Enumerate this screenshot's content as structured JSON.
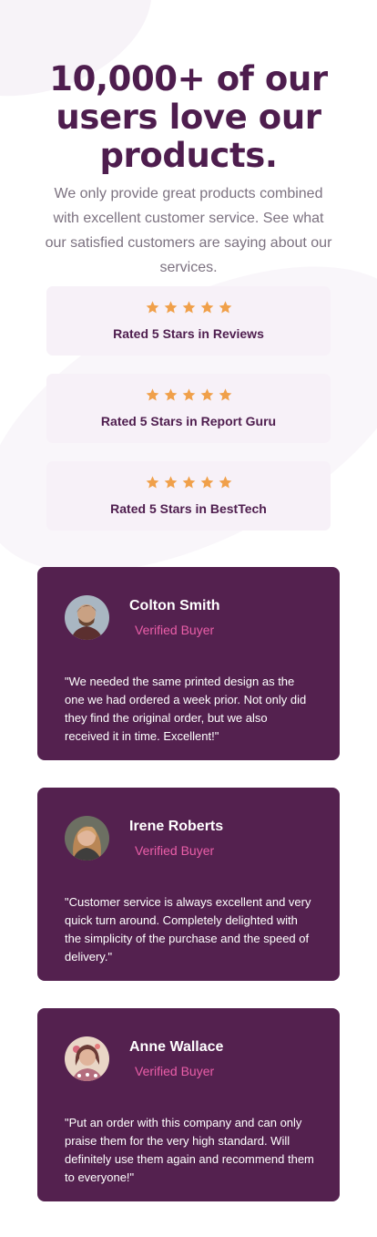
{
  "hero": {
    "title": "10,000+ of our users love our products.",
    "description": "We only provide great products combined with excellent customer service. See what our satisfied customers are saying about our services."
  },
  "ratings": {
    "star_color": "#f0a04a",
    "items": [
      {
        "label": "Rated 5 Stars in Reviews",
        "stars": 5
      },
      {
        "label": "Rated 5 Stars in Report Guru",
        "stars": 5
      },
      {
        "label": "Rated 5 Stars in BestTech",
        "stars": 5
      }
    ]
  },
  "testimonials": {
    "card_color": "#54214f",
    "status_color": "#ea5ea8",
    "items": [
      {
        "name": "Colton Smith",
        "status": "Verified Buyer",
        "quote": "\"We needed the same printed design as the one we had ordered a week prior. Not only did they find the original order, but we also received it in time. Excellent!\"",
        "avatar": "avatar-colton-icon"
      },
      {
        "name": "Irene Roberts",
        "status": "Verified Buyer",
        "quote": "\"Customer service is always excellent and very quick turn around. Completely delighted with the simplicity of the purchase and the speed of delivery.\"",
        "avatar": "avatar-irene-icon"
      },
      {
        "name": "Anne Wallace",
        "status": "Verified Buyer",
        "quote": "\"Put an order with this company and can only praise them for the very high standard. Will definitely use them again and recommend them to everyone!\"",
        "avatar": "avatar-anne-icon"
      }
    ]
  }
}
